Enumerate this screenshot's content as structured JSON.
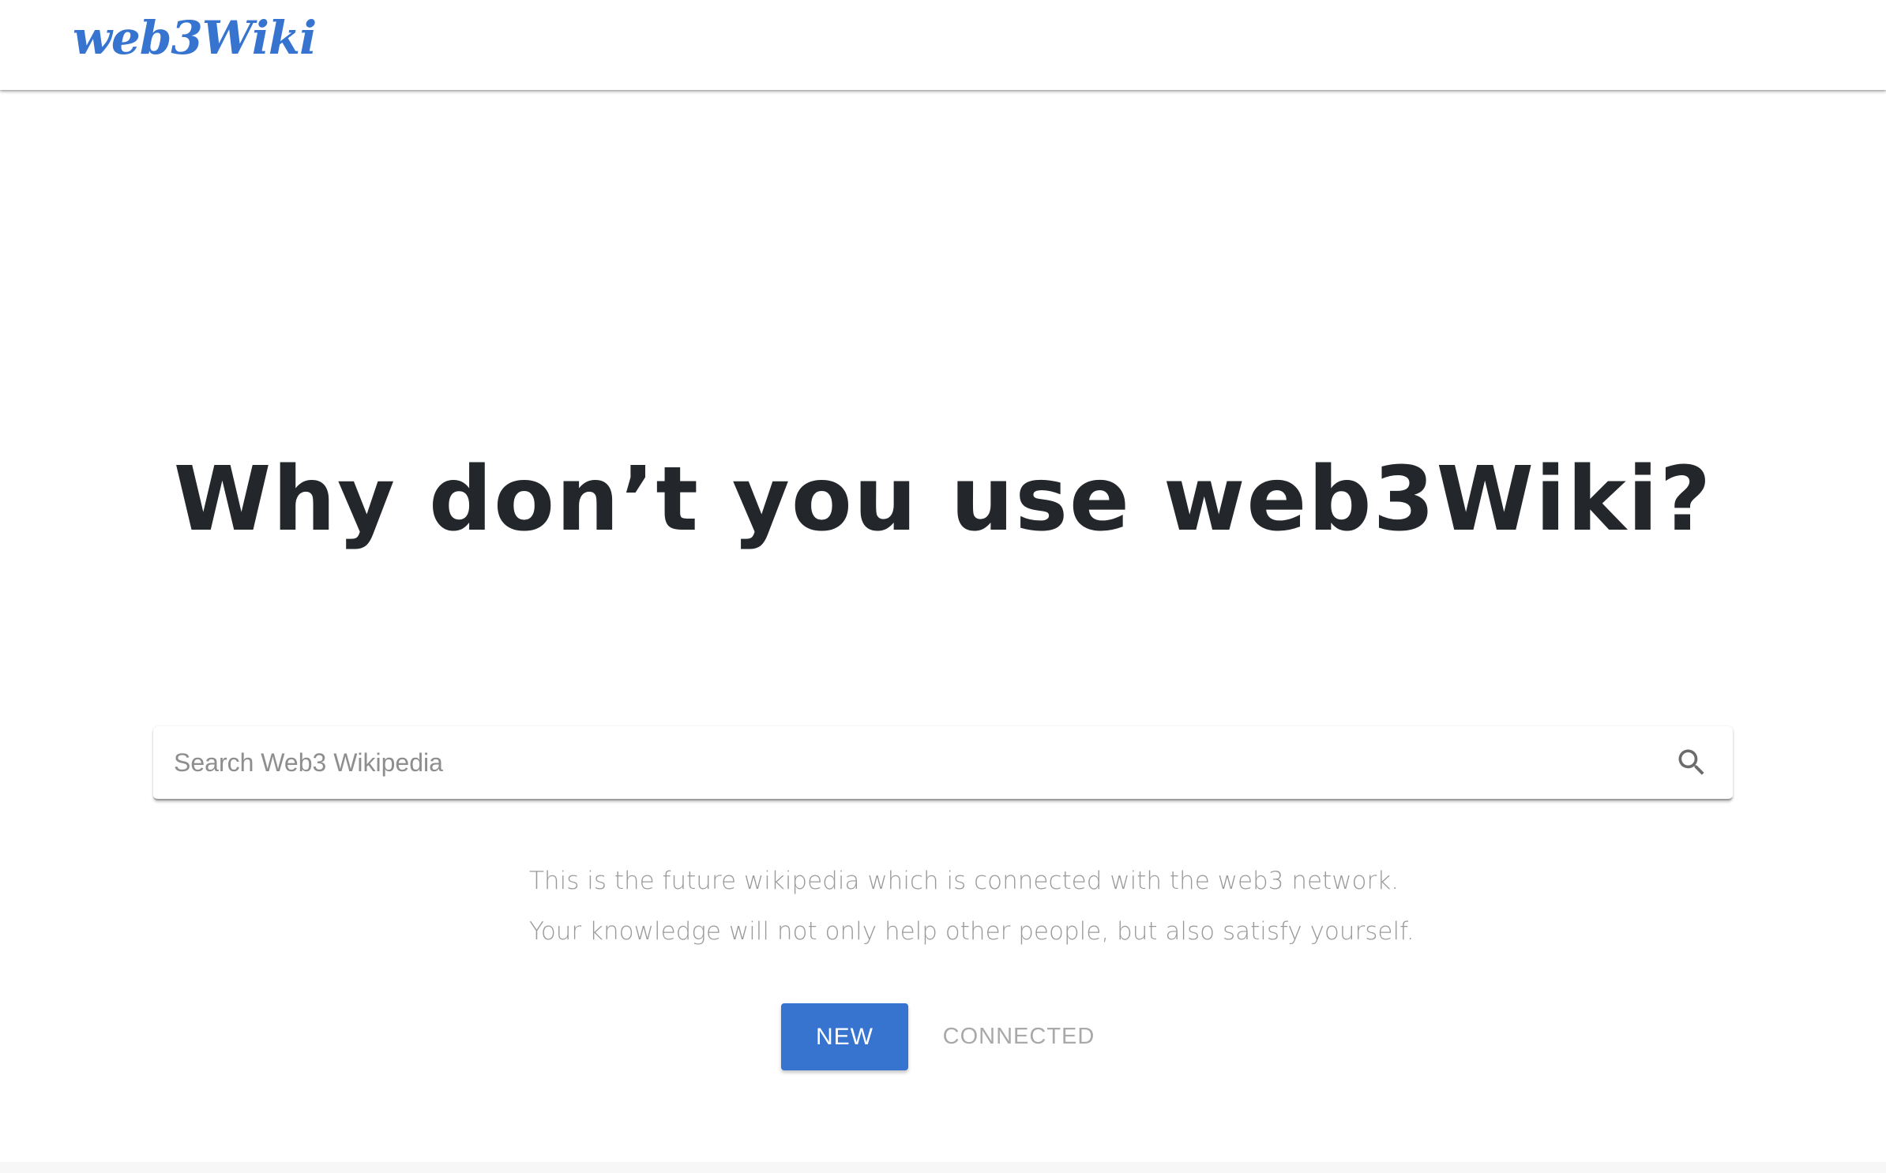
{
  "header": {
    "logo_text": "web3Wiki"
  },
  "hero": {
    "title": "Why don’t you use web3Wiki?"
  },
  "search": {
    "placeholder": "Search Web3 Wikipedia",
    "value": "",
    "icon": "search-icon"
  },
  "description": {
    "line1": "This is the future wikipedia which is connected with the web3 network.",
    "line2": "Your knowledge will not only help other people, but also satisfy yourself."
  },
  "tabs": {
    "new_label": "NEW",
    "connected_label": "CONNECTED",
    "active": "NEW"
  },
  "colors": {
    "accent": "#3674cf",
    "title": "#23262b",
    "muted": "#9a9a9a"
  }
}
